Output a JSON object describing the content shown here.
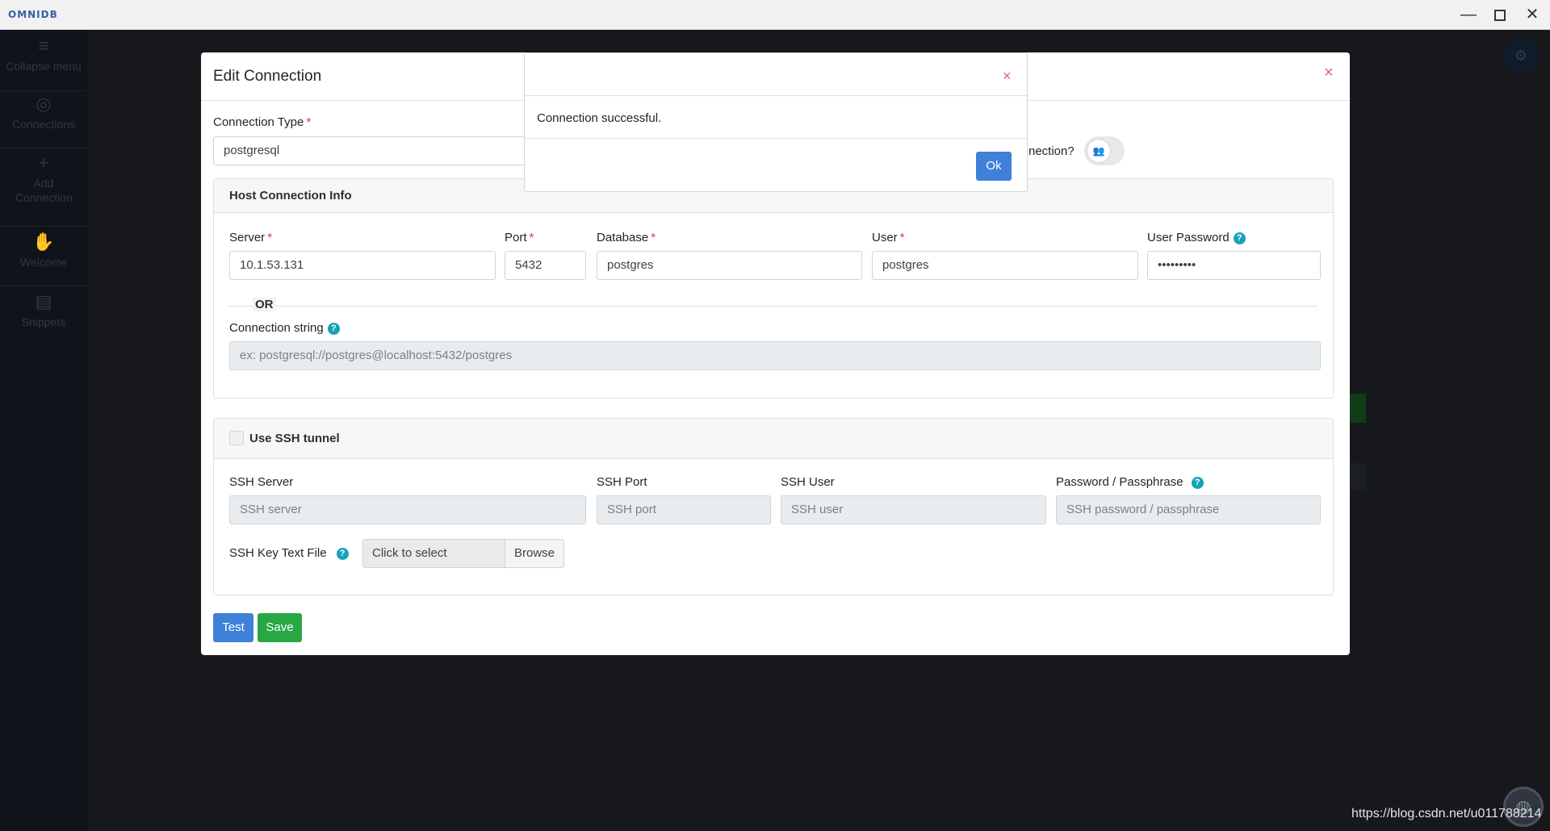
{
  "window": {
    "logo": "OMNIDB",
    "minimize": "—",
    "close": "✕"
  },
  "sidebar": {
    "items": [
      {
        "label": "Collapse menu",
        "icon": "menu-icon",
        "glyph": "≡"
      },
      {
        "label": "Connections",
        "icon": "connections-icon",
        "glyph": "◎"
      },
      {
        "label": "Add Connection",
        "icon": "plus-icon",
        "glyph": "+"
      },
      {
        "label": "Welcome",
        "icon": "hand-icon",
        "glyph": "✋"
      },
      {
        "label": "Snippets",
        "icon": "book-icon",
        "glyph": "▤"
      }
    ]
  },
  "modal": {
    "title": "Edit Connection",
    "close": "×",
    "connection_type_label": "Connection Type",
    "connection_type_value": "postgresql",
    "shared_label": "nection?",
    "shared_icon": "users-icon",
    "host_card": {
      "title": "Host Connection Info",
      "server_label": "Server",
      "server_value": "10.1.53.131",
      "port_label": "Port",
      "port_value": "5432",
      "database_label": "Database",
      "database_value": "postgres",
      "user_label": "User",
      "user_value": "postgres",
      "password_label": "User Password",
      "password_value": "•••••••••",
      "or_label": "OR",
      "connstring_label": "Connection string",
      "connstring_placeholder": "ex: postgresql://postgres@localhost:5432/postgres"
    },
    "ssh_card": {
      "title": "Use SSH tunnel",
      "server_label": "SSH Server",
      "server_placeholder": "SSH server",
      "port_label": "SSH Port",
      "port_placeholder": "SSH port",
      "user_label": "SSH User",
      "user_placeholder": "SSH user",
      "password_label": "Password / Passphrase",
      "password_placeholder": "SSH password / passphrase",
      "keyfile_label": "SSH Key Text File",
      "keyfile_placeholder": "Click to select",
      "browse_label": "Browse"
    },
    "test_label": "Test",
    "save_label": "Save"
  },
  "alert": {
    "close": "×",
    "message": "Connection successful.",
    "ok_label": "Ok"
  },
  "watermark": "https://blog.csdn.net/u011788214",
  "required_mark": "*",
  "help_mark": "?"
}
